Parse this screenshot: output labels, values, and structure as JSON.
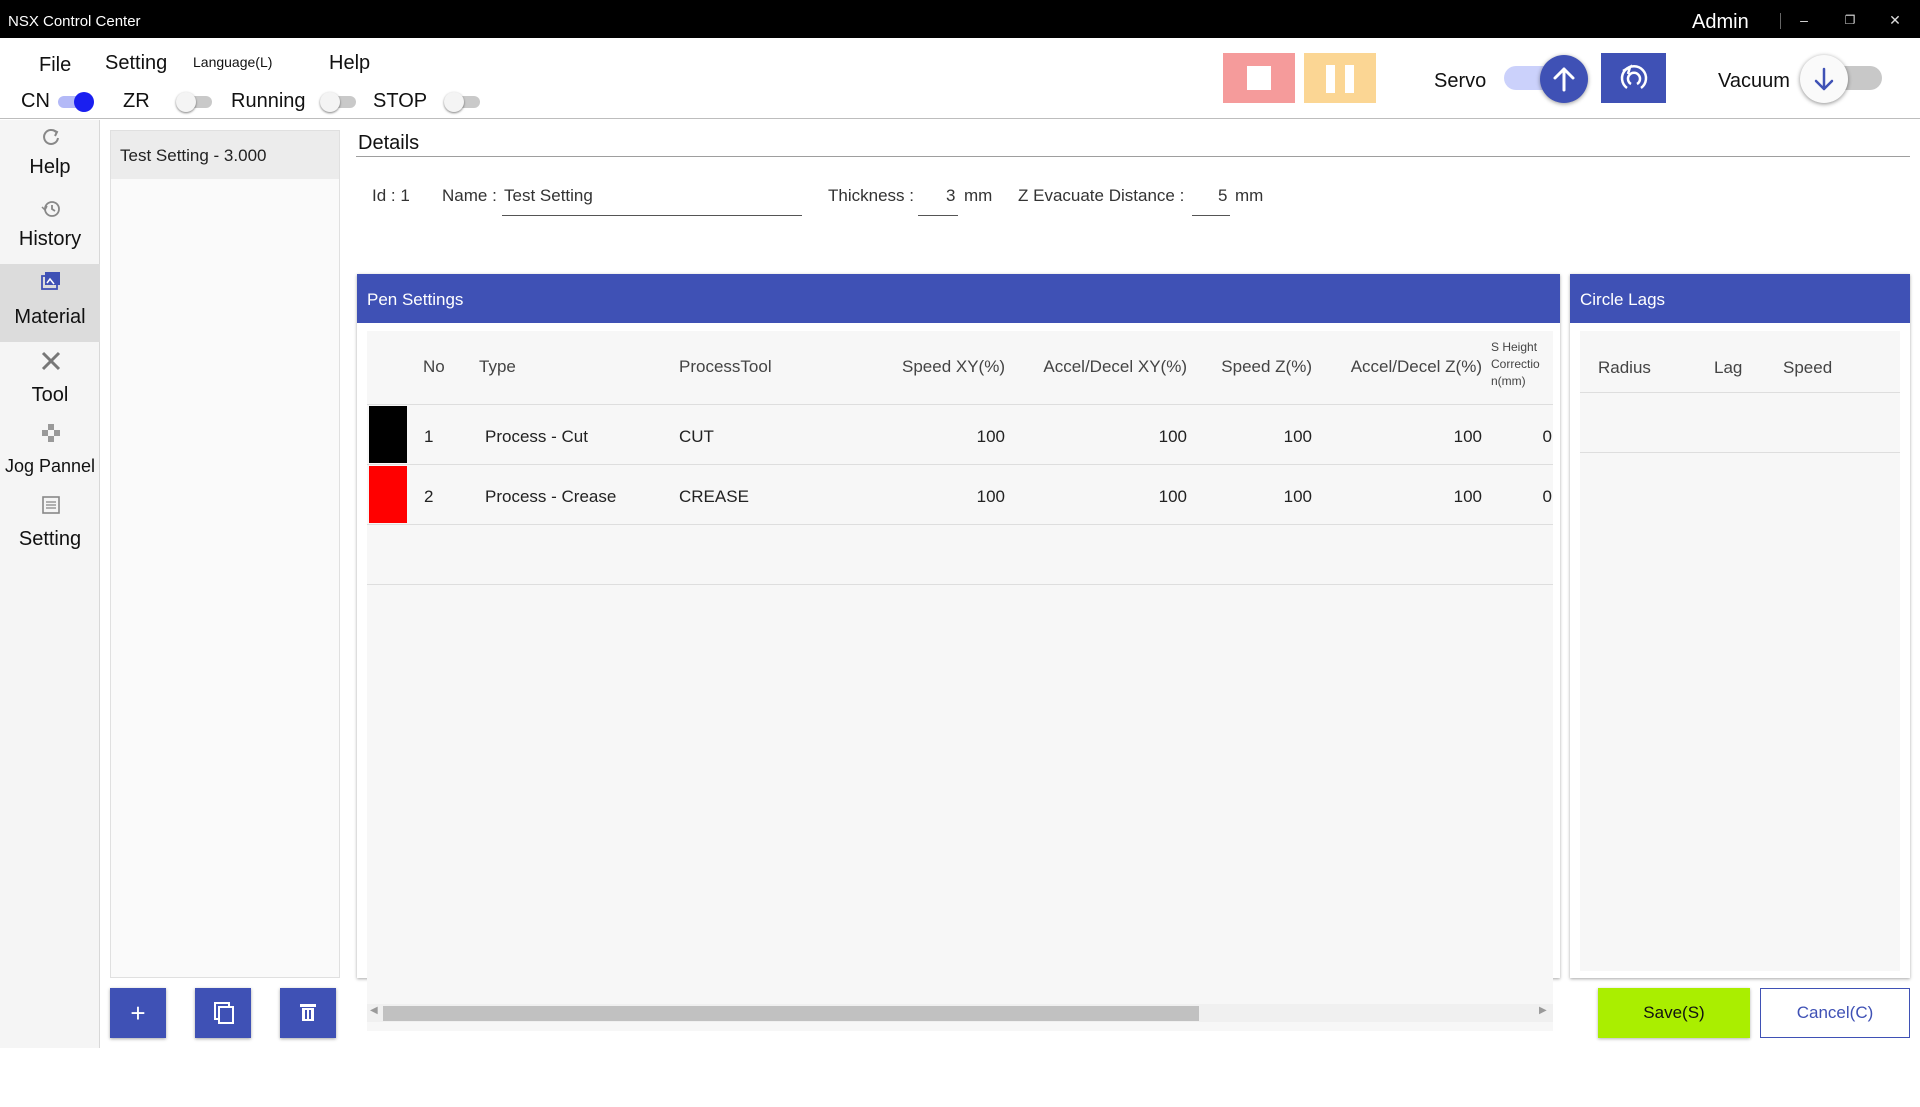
{
  "window": {
    "title": "NSX Control Center",
    "user": "Admin",
    "minimize": "–",
    "restore": "❐",
    "close": "✕"
  },
  "menu": {
    "file": "File",
    "setting": "Setting",
    "language": "Language(L)",
    "help": "Help"
  },
  "status_toggles": [
    {
      "label": "CN",
      "on": true
    },
    {
      "label": "ZR",
      "on": false
    },
    {
      "label": "Running",
      "on": false
    },
    {
      "label": "STOP",
      "on": false
    }
  ],
  "toolbar": {
    "servo_label": "Servo",
    "vacuum_label": "Vacuum"
  },
  "sidebar": {
    "items": [
      {
        "label": "Help",
        "icon": "refresh-icon"
      },
      {
        "label": "History",
        "icon": "history-icon"
      },
      {
        "label": "Material",
        "icon": "images-icon",
        "active": true
      },
      {
        "label": "Tool",
        "icon": "tools-icon"
      },
      {
        "label": "Jog Pannel",
        "icon": "gamepad-icon"
      },
      {
        "label": "Setting",
        "icon": "list-icon"
      }
    ]
  },
  "material_list": {
    "items": [
      "Test Setting - 3.000"
    ]
  },
  "details": {
    "title": "Details",
    "id_label": "Id : 1",
    "name_label": "Name :",
    "name_value": "Test Setting",
    "thickness_label": "Thickness :",
    "thickness_value": "3",
    "thickness_unit": "mm",
    "z_evac_label": "Z Evacuate Distance :",
    "z_evac_value": "5",
    "z_evac_unit": "mm"
  },
  "pen_settings": {
    "title": "Pen Settings",
    "columns": {
      "no": "No",
      "type": "Type",
      "process_tool": "ProcessTool",
      "speed_xy": "Speed XY(%)",
      "accel_xy": "Accel/Decel XY(%)",
      "speed_z": "Speed Z(%)",
      "accel_z": "Accel/Decel Z(%)",
      "height_1": "S Height",
      "height_2": "Correctio",
      "height_3": "n(mm)"
    },
    "rows": [
      {
        "color": "#000000",
        "no": "1",
        "type": "Process - Cut",
        "tool": "CUT",
        "speed_xy": "100",
        "accel_xy": "100",
        "speed_z": "100",
        "accel_z": "100",
        "height": "0"
      },
      {
        "color": "#ff0000",
        "no": "2",
        "type": "Process - Crease",
        "tool": "CREASE",
        "speed_xy": "100",
        "accel_xy": "100",
        "speed_z": "100",
        "accel_z": "100",
        "height": "0"
      }
    ]
  },
  "circle_lags": {
    "title": "Circle Lags",
    "columns": {
      "radius": "Radius",
      "lag": "Lag",
      "speed": "Speed"
    }
  },
  "list_buttons": {
    "add": "+"
  },
  "actions": {
    "save": "Save(S)",
    "cancel": "Cancel(C)"
  },
  "colors": {
    "accent": "#3f51b5",
    "save": "#aaee00",
    "stop": "#f59b9b",
    "pause": "#fbd694"
  }
}
